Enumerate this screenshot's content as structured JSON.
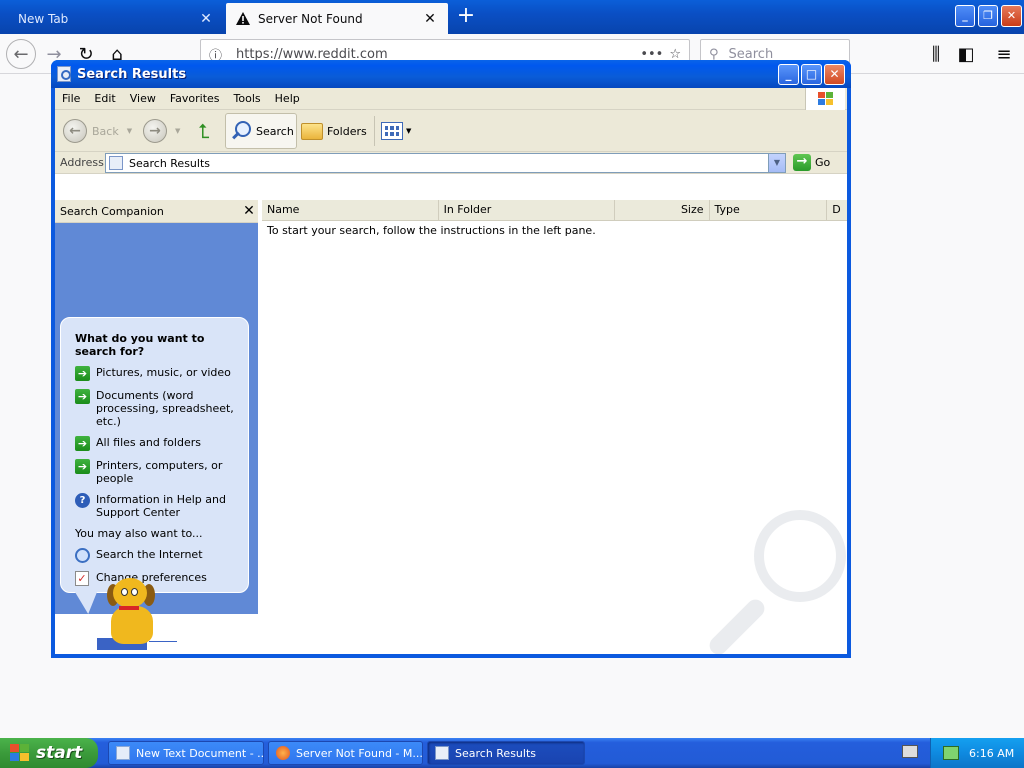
{
  "firefox": {
    "tabs": [
      {
        "label": "New Tab",
        "active": false
      },
      {
        "label": "Server Not Found",
        "active": true
      }
    ],
    "close_glyph": "✕",
    "new_tab_glyph": "+",
    "url": "https://www.reddit.com",
    "url_more": "•••",
    "search_placeholder": "Search",
    "window_buttons": {
      "minimize": "_",
      "maximize": "❐",
      "close": "✕"
    }
  },
  "window": {
    "title": "Search Results",
    "menu": [
      "File",
      "Edit",
      "View",
      "Favorites",
      "Tools",
      "Help"
    ],
    "toolbar": {
      "back": "Back",
      "search": "Search",
      "folders": "Folders"
    },
    "address": {
      "label": "Address",
      "value": "Search Results",
      "go": "Go"
    }
  },
  "companion": {
    "header": "Search Companion",
    "question": "What do you want to search for?",
    "options": [
      {
        "label": "Pictures, music, or video",
        "icon": "arrow-icon"
      },
      {
        "label": "Documents (word processing, spreadsheet, etc.)",
        "icon": "arrow-icon"
      },
      {
        "label": "All files and folders",
        "icon": "arrow-icon"
      },
      {
        "label": "Printers, computers, or people",
        "icon": "arrow-icon"
      },
      {
        "label": "Information in Help and Support Center",
        "icon": "help-icon"
      }
    ],
    "also_label": "You may also want to...",
    "also_options": [
      {
        "label": "Search the Internet",
        "icon": "globe-search-icon"
      },
      {
        "label": "Change preferences",
        "icon": "preferences-icon"
      }
    ]
  },
  "results": {
    "columns": [
      "Name",
      "In Folder",
      "Size",
      "Type",
      "D"
    ],
    "message": "To start your search, follow the instructions in the left pane."
  },
  "taskbar": {
    "start": "start",
    "tasks": [
      {
        "label": "New Text Document - ...",
        "active": false
      },
      {
        "label": "Server Not Found - M...",
        "active": false
      },
      {
        "label": "Search Results",
        "active": true
      }
    ],
    "clock": "6:16 AM"
  },
  "colors": {
    "xp_blue": "#0c5adf",
    "companion_blue": "#6089d6",
    "start_green": "#3b9b3b",
    "menu_bg": "#ece9d8"
  }
}
